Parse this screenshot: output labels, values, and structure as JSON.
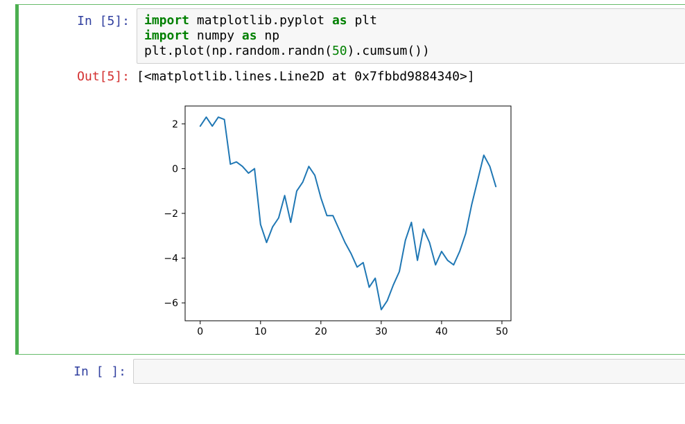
{
  "cell": {
    "in_prompt": "In [5]:",
    "out_prompt": "Out[5]:",
    "next_prompt": "In [ ]:",
    "code": {
      "kw_import1": "import",
      "mod_mpl": " matplotlib.pyplot ",
      "kw_as1": "as",
      "alias_plt": " plt",
      "nl1": "\n",
      "kw_import2": "import",
      "mod_np": " numpy ",
      "kw_as2": "as",
      "alias_np": " np",
      "nl2": "\n",
      "line3a": "plt.plot(np.random.randn(",
      "num50": "50",
      "line3b": ").cumsum())"
    },
    "output_text": "[<matplotlib.lines.Line2D at 0x7fbbd9884340>]"
  },
  "chart_data": {
    "type": "line",
    "x": [
      0,
      1,
      2,
      3,
      4,
      5,
      6,
      7,
      8,
      9,
      10,
      11,
      12,
      13,
      14,
      15,
      16,
      17,
      18,
      19,
      20,
      21,
      22,
      23,
      24,
      25,
      26,
      27,
      28,
      29,
      30,
      31,
      32,
      33,
      34,
      35,
      36,
      37,
      38,
      39,
      40,
      41,
      42,
      43,
      44,
      45,
      46,
      47,
      48,
      49
    ],
    "values": [
      1.9,
      2.3,
      1.9,
      2.3,
      2.2,
      0.2,
      0.3,
      0.1,
      -0.2,
      0.0,
      -2.5,
      -3.3,
      -2.6,
      -2.2,
      -1.2,
      -2.4,
      -1.0,
      -0.6,
      0.1,
      -0.3,
      -1.3,
      -2.1,
      -2.1,
      -2.7,
      -3.3,
      -3.8,
      -4.4,
      -4.2,
      -5.3,
      -4.9,
      -6.3,
      -5.9,
      -5.2,
      -4.6,
      -3.2,
      -2.4,
      -4.1,
      -2.7,
      -3.3,
      -4.3,
      -3.7,
      -4.1,
      -4.3,
      -3.7,
      -2.9,
      -1.6,
      -0.5,
      0.6,
      0.1,
      -0.8
    ],
    "xticks": [
      0,
      10,
      20,
      30,
      40,
      50
    ],
    "yticks": [
      -6,
      -4,
      -2,
      0,
      2
    ],
    "xlim": [
      -2.5,
      51.5
    ],
    "ylim": [
      -6.8,
      2.8
    ],
    "line_color": "#1f77b4",
    "title": "",
    "xlabel": "",
    "ylabel": ""
  }
}
